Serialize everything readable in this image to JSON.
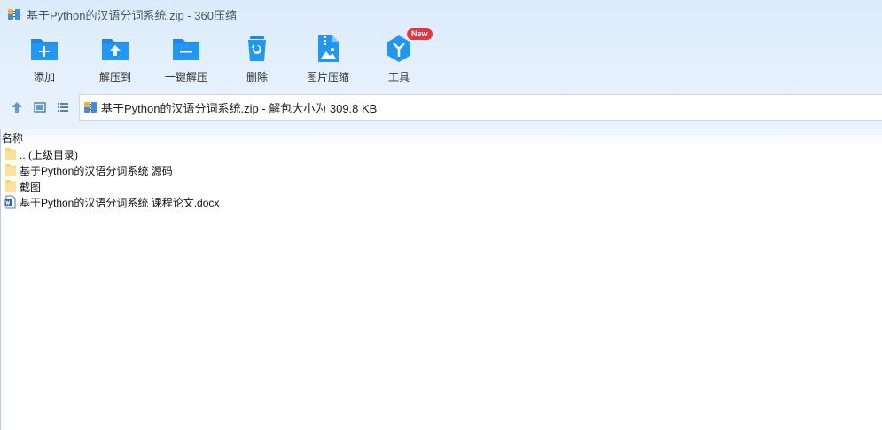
{
  "window": {
    "title": "基于Python的汉语分词系统.zip - 360压缩"
  },
  "toolbar": {
    "items": [
      {
        "label": "添加",
        "icon": "folder-add-icon"
      },
      {
        "label": "解压到",
        "icon": "folder-extract-icon"
      },
      {
        "label": "一键解压",
        "icon": "folder-quick-extract-icon"
      },
      {
        "label": "删除",
        "icon": "recycle-bin-icon"
      },
      {
        "label": "图片压缩",
        "icon": "image-compress-icon"
      },
      {
        "label": "工具",
        "icon": "tools-icon",
        "badge": "New"
      }
    ]
  },
  "nav": {
    "path": "基于Python的汉语分词系统.zip - 解包大小为 309.8 KB"
  },
  "list": {
    "column_header": "名称",
    "rows": [
      {
        "label": ".. (上级目录)",
        "type": "folder"
      },
      {
        "label": "基于Python的汉语分词系统 源码",
        "type": "folder"
      },
      {
        "label": "截图",
        "type": "folder"
      },
      {
        "label": "基于Python的汉语分词系统 课程论文.docx",
        "type": "docx"
      }
    ]
  },
  "colors": {
    "accent": "#1e88e5",
    "chrome_bg": "#dcebfb",
    "badge": "#e8343b"
  }
}
